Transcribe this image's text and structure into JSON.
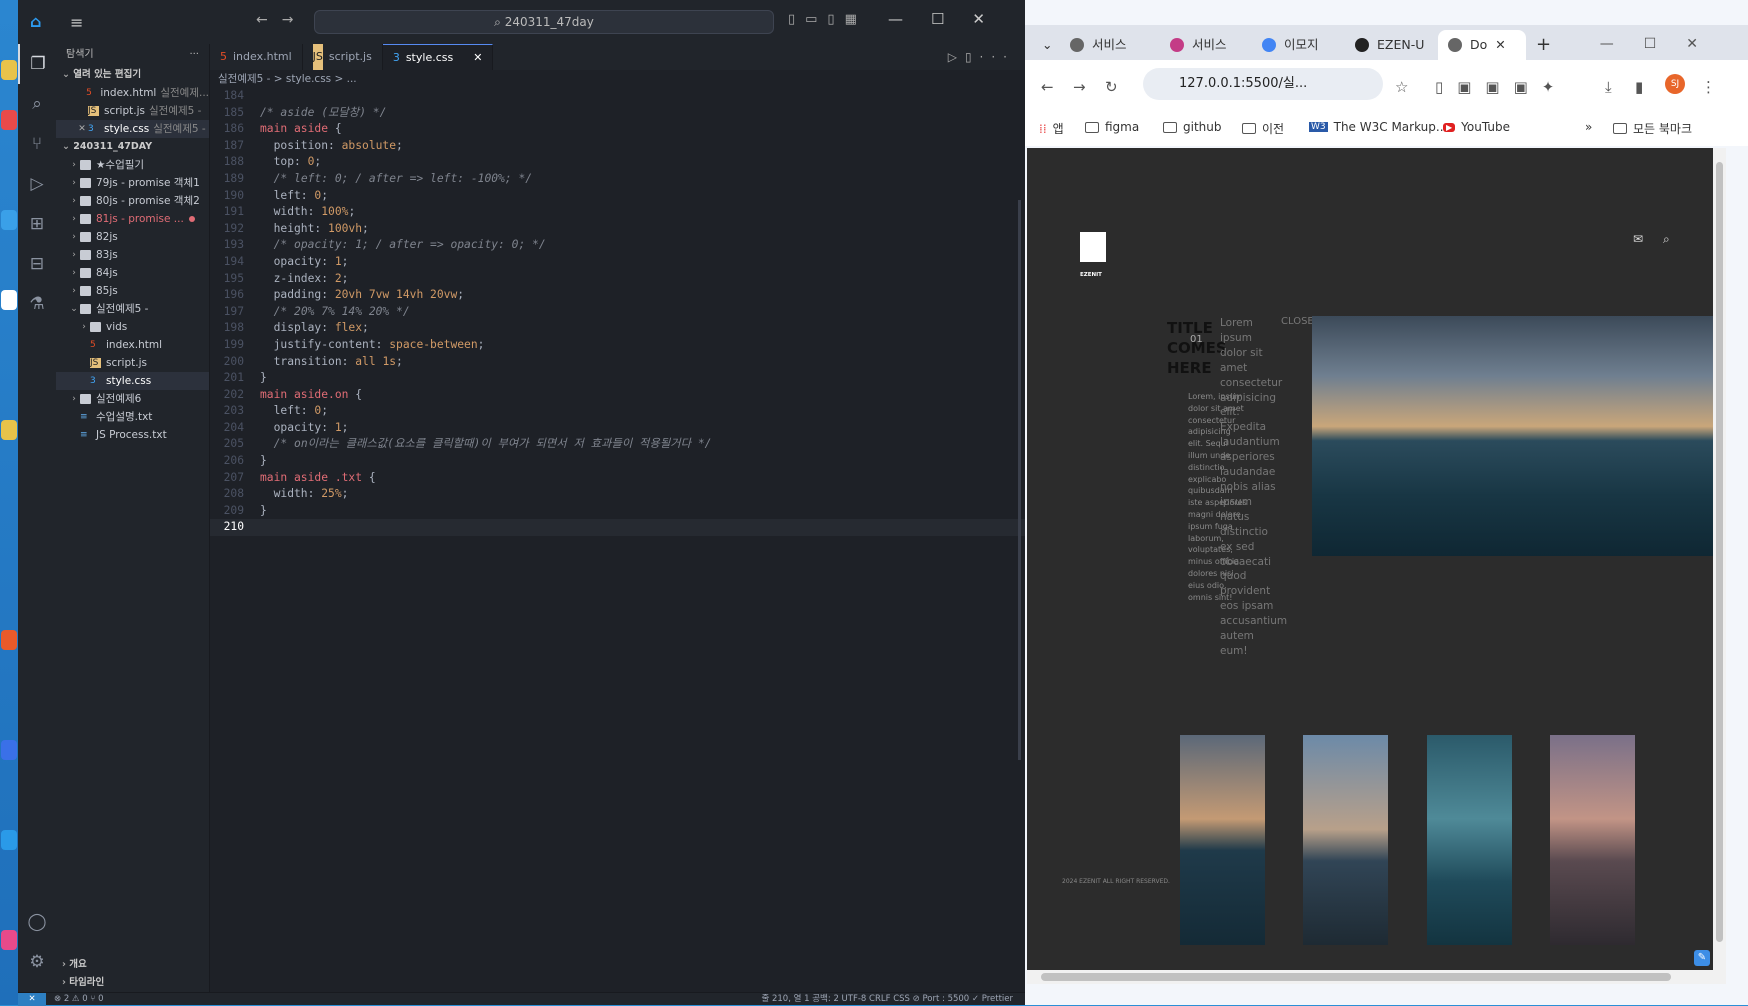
{
  "vscode": {
    "title_search": "240311_47day",
    "tabs": [
      {
        "label": "index.html",
        "type": "html"
      },
      {
        "label": "script.js",
        "type": "js"
      },
      {
        "label": "style.css",
        "type": "css",
        "active": true
      }
    ],
    "breadcrumb": "실전예제5 -  >  style.css  >  ...",
    "sidebar": {
      "header": "탐색기",
      "open_editors_label": "열려 있는 편집기",
      "open_editors": [
        {
          "name": "index.html",
          "sub": "실전예제...",
          "type": "html"
        },
        {
          "name": "script.js",
          "sub": "실전예제5 -",
          "type": "js"
        },
        {
          "name": "style.css",
          "sub": "실전예제5 -",
          "type": "css",
          "selected": true
        }
      ],
      "workspace_label": "240311_47DAY",
      "tree": [
        {
          "name": "★수업필기",
          "type": "folder",
          "depth": 1
        },
        {
          "name": "79js - promise 객체1",
          "type": "folder",
          "depth": 1
        },
        {
          "name": "80js - promise 객체2",
          "type": "folder",
          "depth": 1
        },
        {
          "name": "81js - promise ...",
          "type": "folder",
          "depth": 1,
          "error": true
        },
        {
          "name": "82js",
          "type": "folder",
          "depth": 1
        },
        {
          "name": "83js",
          "type": "folder",
          "depth": 1
        },
        {
          "name": "84js",
          "type": "folder",
          "depth": 1
        },
        {
          "name": "85js",
          "type": "folder",
          "depth": 1
        },
        {
          "name": "실전예제5 -",
          "type": "folder",
          "depth": 1,
          "open": true
        },
        {
          "name": "vids",
          "type": "folder",
          "depth": 2
        },
        {
          "name": "index.html",
          "type": "html",
          "depth": 2
        },
        {
          "name": "script.js",
          "type": "js",
          "depth": 2
        },
        {
          "name": "style.css",
          "type": "css",
          "depth": 2,
          "selected": true
        },
        {
          "name": "실전예제6",
          "type": "folder",
          "depth": 1
        },
        {
          "name": "수업설명.txt",
          "type": "txt",
          "depth": 1
        },
        {
          "name": "JS Process.txt",
          "type": "txt",
          "depth": 1
        }
      ],
      "outline_label": "개요",
      "timeline_label": "타임라인"
    },
    "code_lines": [
      {
        "n": "184",
        "html": ""
      },
      {
        "n": "185",
        "html": "<span class='t-cm'>/* aside (모달창) */</span>"
      },
      {
        "n": "186",
        "html": "<span class='t-sel'>main aside</span> {"
      },
      {
        "n": "187",
        "html": "  position: <span class='t-kw'>absolute</span>;"
      },
      {
        "n": "188",
        "html": "  top: <span class='t-val'>0</span>;"
      },
      {
        "n": "189",
        "html": "  <span class='t-cm'>/* left: 0; / after => left: -100%; */</span>"
      },
      {
        "n": "190",
        "html": "  left: <span class='t-val'>0</span>;"
      },
      {
        "n": "191",
        "html": "  width: <span class='t-val'>100%</span>;"
      },
      {
        "n": "192",
        "html": "  height: <span class='t-val'>100vh</span>;"
      },
      {
        "n": "193",
        "html": "  <span class='t-cm'>/* opacity: 1; / after => opacity: 0; */</span>"
      },
      {
        "n": "194",
        "html": "  opacity: <span class='t-val'>1</span>;"
      },
      {
        "n": "195",
        "html": "  z-index: <span class='t-val'>2</span>;"
      },
      {
        "n": "196",
        "html": "  padding: <span class='t-val'>20vh 7vw 14vh 20vw</span>;"
      },
      {
        "n": "197",
        "html": "  <span class='t-cm'>/* 20% 7% 14% 20% */</span>"
      },
      {
        "n": "198",
        "html": "  display: <span class='t-kw'>flex</span>;"
      },
      {
        "n": "199",
        "html": "  justify-content: <span class='t-kw'>space-between</span>;"
      },
      {
        "n": "200",
        "html": "  transition: <span class='t-kw'>all</span> <span class='t-val'>1s</span>;"
      },
      {
        "n": "201",
        "html": "}"
      },
      {
        "n": "202",
        "html": "<span class='t-sel'>main aside.on</span> {"
      },
      {
        "n": "203",
        "html": "  left: <span class='t-val'>0</span>;"
      },
      {
        "n": "204",
        "html": "  opacity: <span class='t-val'>1</span>;"
      },
      {
        "n": "205",
        "html": "  <span class='t-cm'>/* on이라는 클래스값(요소를 클릭할때)이 부여가 되면서 저 효과들이 적용될거다 */</span>"
      },
      {
        "n": "206",
        "html": "}"
      },
      {
        "n": "207",
        "html": "<span class='t-sel'>main aside .txt</span> {"
      },
      {
        "n": "208",
        "html": "  width: <span class='t-val'>25%</span>;"
      },
      {
        "n": "209",
        "html": "}"
      },
      {
        "n": "210",
        "html": "",
        "current": true
      }
    ],
    "status": {
      "left": "⊗ 2 ⚠ 0    ⑂ 0",
      "right": "줄 210, 열 1    공백: 2    UTF-8    CRLF    CSS    ⊘ Port : 5500    ✓ Prettier"
    }
  },
  "chrome": {
    "tabs": [
      "서비스",
      "서비스",
      "이모지",
      "EZEN-U",
      "Do"
    ],
    "url": "127.0.0.1:5500/실...",
    "bookmarks": [
      "앱",
      "figma",
      "github",
      "이전",
      "The W3C Markup...",
      "YouTube",
      "모든 북마크"
    ],
    "page": {
      "logo_text": "EZENIT",
      "title": "TITLE COMES HERE",
      "number": "01",
      "para1": "Lorem, ipsum dolor sit amet consectetur adipisicing elit. Sequi illum unde distinctio explicabo quibusdam iste asperiores magni dolore ipsum fuga laborum, voluptates, minus officia dolores nisi eius odio, omnis sint!",
      "para2": "Lorem ipsum dolor sit amet consectetur adipisicing elit. Expedita laudantium asperiores laudandae nobis alias ipsum natus distinctio ex sed obcaecati quod provident eos ipsam accusantium autem eum!",
      "close_label": "CLOSE",
      "copyright": "2024 EZENIT ALL RIGHT RESERVED."
    }
  }
}
